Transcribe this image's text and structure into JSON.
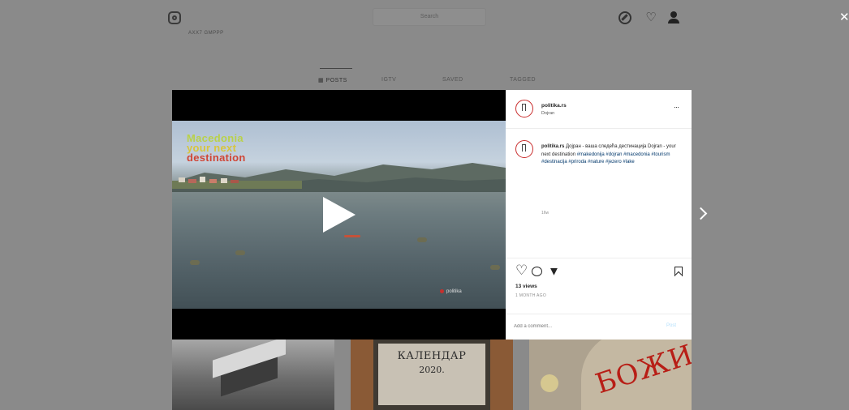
{
  "background_page": {
    "username": "AXX7 GMPPP",
    "search_placeholder": "Search",
    "tabs": [
      {
        "label": "▦ POSTS",
        "active": true
      },
      {
        "label": "IGTV",
        "active": false
      },
      {
        "label": "SAVED",
        "active": false
      },
      {
        "label": "TAGGED",
        "active": false
      }
    ],
    "close_label": "✕",
    "thumbnails": [
      {
        "text": ""
      },
      {
        "text_line1": "КАЛЕНДАР",
        "text_line2": "2020."
      },
      {
        "text": "БОЖИ"
      }
    ]
  },
  "video": {
    "caption_lines": [
      "Macedonia",
      "your next",
      "destination"
    ],
    "watermark": "politika"
  },
  "post": {
    "username": "politika.rs",
    "location": "Dojran",
    "more_label": "···",
    "caption_username": "politika.rs",
    "caption_text": "Дојран - ваша следећа дестинација Dojran - your next destination",
    "caption_tags": "#makedonija #dojran #macedonia #tourism #destinacija #priroda #nature #jezero #lake",
    "caption_time": "16w",
    "views": "13 views",
    "date": "1 MONTH AGO",
    "comment_placeholder": "Add a comment...",
    "post_label": "Post"
  },
  "colors": {
    "overlay_bg": "#7a7a7a",
    "panel_bg": "#ffffff",
    "avatar_ring": "#c92c2c",
    "hashtag": "#00376b",
    "post_button": "#b2dffc",
    "caption_green": "#b9d14a",
    "caption_yellow": "#d7c53e",
    "caption_red": "#d04535"
  },
  "icons": [
    "instagram-logo-icon",
    "compass-icon",
    "heart-icon",
    "profile-icon",
    "close-icon",
    "play-icon",
    "more-icon",
    "comment-icon",
    "share-icon",
    "bookmark-icon",
    "chevron-right-icon"
  ]
}
